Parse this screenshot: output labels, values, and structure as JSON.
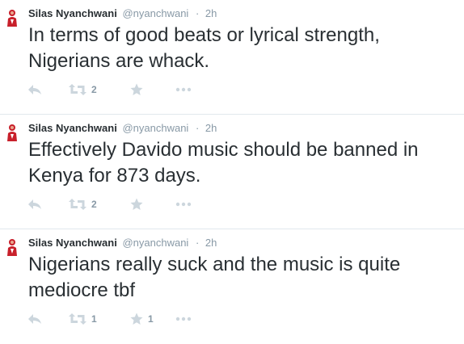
{
  "colors": {
    "name": "#292f33",
    "muted": "#8899a6",
    "icon": "#ccd6dd",
    "divider": "#e1e8ed",
    "avatar_red": "#c8202b"
  },
  "tweets": [
    {
      "author": "Silas Nyanchwani",
      "handle": "@nyanchwani",
      "separator": "·",
      "time": "2h",
      "text": "In terms of good beats or lyrical strength, Nigerians are whack.",
      "retweets": "2",
      "favorites": "",
      "icons": [
        "avatar",
        "reply-icon",
        "retweet-icon",
        "favorite-icon",
        "more-icon"
      ]
    },
    {
      "author": "Silas Nyanchwani",
      "handle": "@nyanchwani",
      "separator": "·",
      "time": "2h",
      "text": "Effectively Davido music should be banned in Kenya for 873 days.",
      "retweets": "2",
      "favorites": "",
      "icons": [
        "avatar",
        "reply-icon",
        "retweet-icon",
        "favorite-icon",
        "more-icon"
      ]
    },
    {
      "author": "Silas Nyanchwani",
      "handle": "@nyanchwani",
      "separator": "·",
      "time": "2h",
      "text": "Nigerians really suck and the music is quite mediocre tbf",
      "retweets": "1",
      "favorites": "1",
      "icons": [
        "avatar",
        "reply-icon",
        "retweet-icon",
        "favorite-icon",
        "more-icon"
      ]
    }
  ]
}
